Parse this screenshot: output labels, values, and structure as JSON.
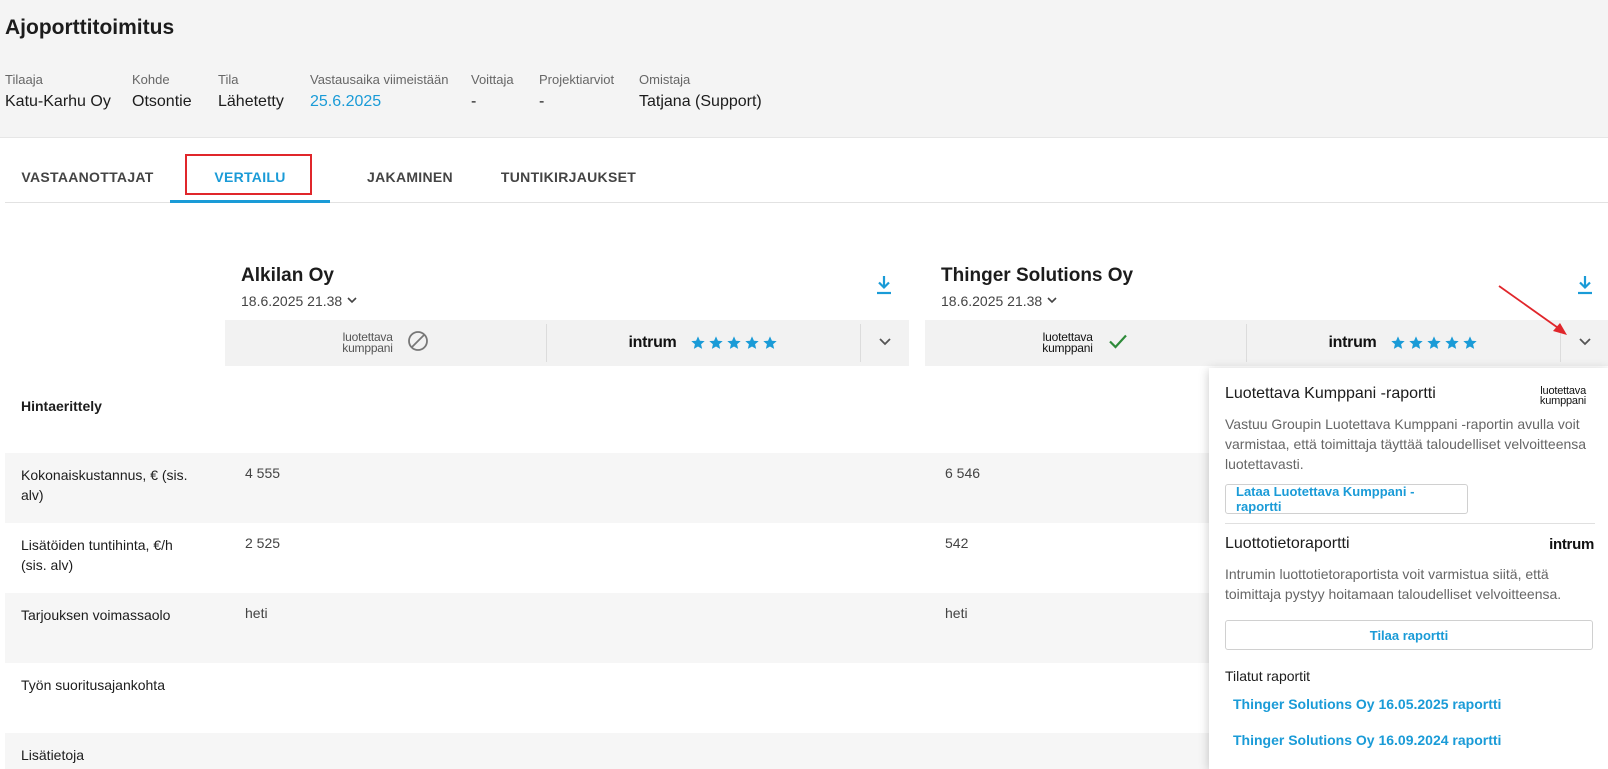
{
  "page": {
    "title": "Ajoporttitoimitus"
  },
  "meta": [
    {
      "label": "Tilaaja",
      "value": "Katu-Karhu Oy"
    },
    {
      "label": "Kohde",
      "value": "Otsontie"
    },
    {
      "label": "Tila",
      "value": "Lähetetty"
    },
    {
      "label": "Vastausaika viimeistään",
      "value": "25.6.2025"
    },
    {
      "label": "Voittaja",
      "value": "-"
    },
    {
      "label": "Projektiarviot",
      "value": "-"
    },
    {
      "label": "Omistaja",
      "value": "Tatjana (Support)"
    }
  ],
  "tabs": [
    {
      "label": "VASTAANOTTAJAT"
    },
    {
      "label": "VERTAILU"
    },
    {
      "label": "JAKAMINEN"
    },
    {
      "label": "TUNTIKIRJAUKSET"
    }
  ],
  "active_tab": "VERTAILU",
  "suppliers": [
    {
      "name": "Alkilan Oy",
      "date": "18.6.2025 21.38",
      "lk_logo_top": "luotettava",
      "lk_logo_bottom": "kumppani",
      "lk_status": "not-available",
      "intrum_logo": "intrum",
      "stars": 5
    },
    {
      "name": "Thinger Solutions Oy",
      "date": "18.6.2025 21.38",
      "lk_logo_top": "luotettava",
      "lk_logo_bottom": "kumppani",
      "lk_status": "ok",
      "intrum_logo": "intrum",
      "stars": 5
    }
  ],
  "rows": [
    {
      "label": "Hintaerittely",
      "values": [
        "",
        ""
      ]
    },
    {
      "label": "Kokonaiskustannus, € (sis. alv)",
      "values": [
        "4 555",
        "6 546"
      ]
    },
    {
      "label": "Lisätöiden tuntihinta, €/h (sis. alv)",
      "values": [
        "2 525",
        "542"
      ]
    },
    {
      "label": "Tarjouksen voimassaolo",
      "values": [
        "heti",
        "heti"
      ]
    },
    {
      "label": "Työn suoritusajankohta",
      "values": [
        "",
        ""
      ]
    },
    {
      "label": "Lisätietoja",
      "values": [
        "",
        ""
      ]
    }
  ],
  "popover": {
    "lk_title": "Luotettava Kumppani -raportti",
    "lk_logo_top": "luotettava",
    "lk_logo_bottom": "kumppani",
    "lk_desc": "Vastuu Groupin Luotettava Kumppani -raportin avulla voit varmistaa, että toimittaja täyttää taloudelliset velvoitteensa luotettavasti.",
    "lk_button": "Lataa Luotettava Kumppani -raportti",
    "credit_title": "Luottotietoraportti",
    "credit_logo": "intrum",
    "credit_desc": "Intrumin luottotietoraportista voit varmistua siitä, että toimittaja pystyy hoitamaan taloudelliset velvoitteensa.",
    "credit_button": "Tilaa raportti",
    "ordered_title": "Tilatut raportit",
    "ordered_reports": [
      "Thinger Solutions Oy 16.05.2025 raportti",
      "Thinger Solutions Oy 16.09.2024 raportti"
    ]
  },
  "colors": {
    "accent": "#1a9bd7",
    "highlight": "#e0262b",
    "check": "#2e8b3a"
  }
}
